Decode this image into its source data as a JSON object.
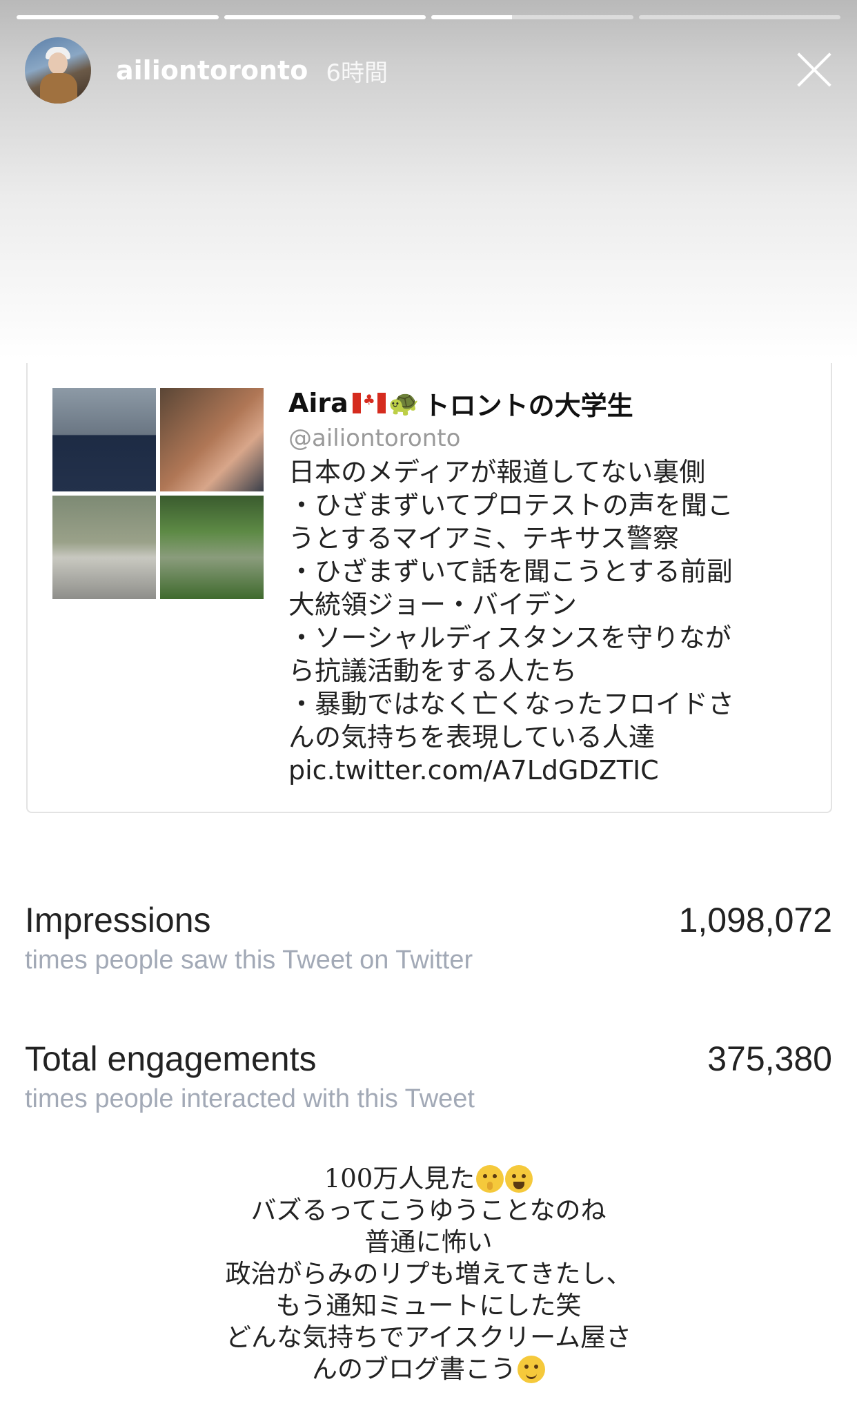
{
  "story": {
    "progress": [
      1.0,
      1.0,
      0.4,
      0.0
    ],
    "username": "ailiontoronto",
    "time": "6時間"
  },
  "tweet": {
    "author_name": "Aira",
    "author_suffix": "トロントの大学生",
    "flag_icon": "canada-flag-icon",
    "author_icon": "turtle-icon",
    "handle": "@ailiontoronto",
    "body": "日本のメディアが報道してない裏側\n・ひざまずいてプロテストの声を聞こ\nうとするマイアミ、テキサス警察\n・ひざまずいて話を聞こうとする前副\n大統領ジョー・バイデン\n・ソーシャルディスタンスを守りなが\nら抗議活動をする人たち\n・暴動ではなく亡くなったフロイドさ\nんの気持ちを表現している人達\npic.twitter.com/A7LdGDZTIC"
  },
  "metrics": [
    {
      "label": "Impressions",
      "sub": "times people saw this Tweet on Twitter",
      "value": "1,098,072"
    },
    {
      "label": "Total engagements",
      "sub": "times people interacted with this Tweet",
      "value": "375,380"
    }
  ],
  "caption": {
    "lines": [
      "100万人見た",
      "バズるってこうゆうことなのね",
      "普通に怖い",
      "政治がらみのリプも増えてきたし、",
      "もう通知ミュートにした笑",
      "どんな気持ちでアイスクリーム屋さ",
      "んのブログ書こう"
    ],
    "line1_emojis": [
      "shushing-face-emoji",
      "tears-of-joy-emoji"
    ],
    "line7_emoji": "smiling-face-emoji"
  }
}
